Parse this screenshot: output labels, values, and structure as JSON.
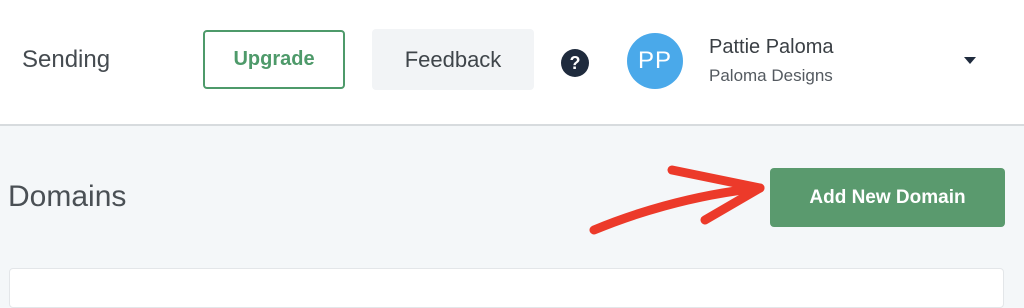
{
  "header": {
    "nav_sending": "Sending",
    "upgrade_label": "Upgrade",
    "feedback_label": "Feedback",
    "help_glyph": "?",
    "user": {
      "initials": "PP",
      "name": "Pattie Paloma",
      "organization": "Paloma Designs"
    }
  },
  "main": {
    "title": "Domains",
    "add_button_label": "Add New Domain"
  },
  "colors": {
    "accent_green": "#5a9a6e",
    "upgrade_green": "#4e9a6a",
    "avatar_blue": "#4aa9ea",
    "annotation_red": "#ec3a2a",
    "help_navy": "#1f2b3d"
  }
}
